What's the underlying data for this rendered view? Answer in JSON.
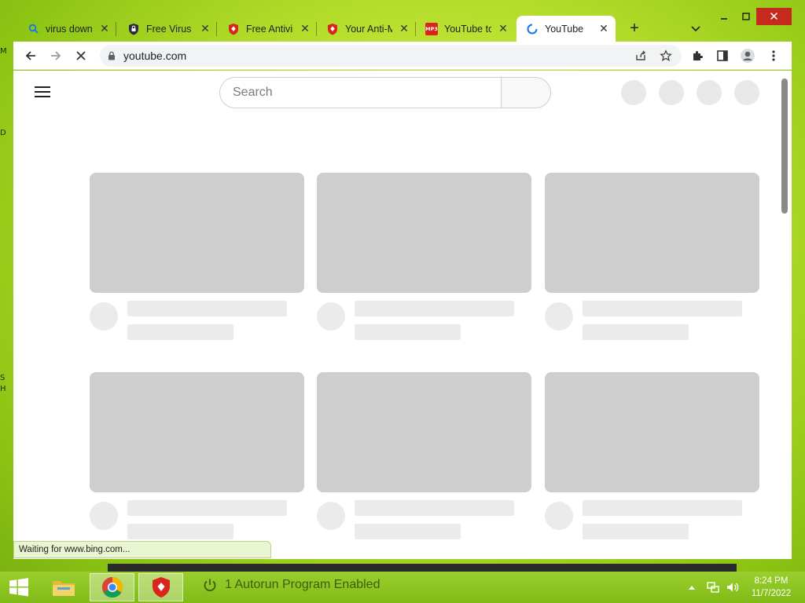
{
  "browser": {
    "tabs": [
      {
        "title": "virus downl",
        "icon": "search-icon"
      },
      {
        "title": "Free Virus F",
        "icon": "shield-lock-icon"
      },
      {
        "title": "Free Antivir",
        "icon": "red-shield-icon"
      },
      {
        "title": "Your Anti-M",
        "icon": "red-shield-icon"
      },
      {
        "title": "YouTube to",
        "icon": "mp3-icon",
        "icon_text": "MP3"
      },
      {
        "title": "YouTube",
        "icon": "loading-spinner-icon"
      }
    ],
    "active_tab": 5,
    "new_tab_label": "+",
    "url": "youtube.com",
    "status_text": "Waiting for www.bing.com..."
  },
  "page": {
    "search_placeholder": "Search"
  },
  "taskbar": {
    "autorun_text": "1 Autorun Program Enabled",
    "time": "8:24 PM",
    "date": "11/7/2022"
  },
  "desktop": {
    "edge_fragments": [
      "M",
      "D",
      "S",
      "H"
    ]
  },
  "colors": {
    "desktop": "#b6de2c",
    "taskbar": "#8cc71e",
    "close_button": "#c42b1c",
    "skeleton": "#cecece"
  }
}
